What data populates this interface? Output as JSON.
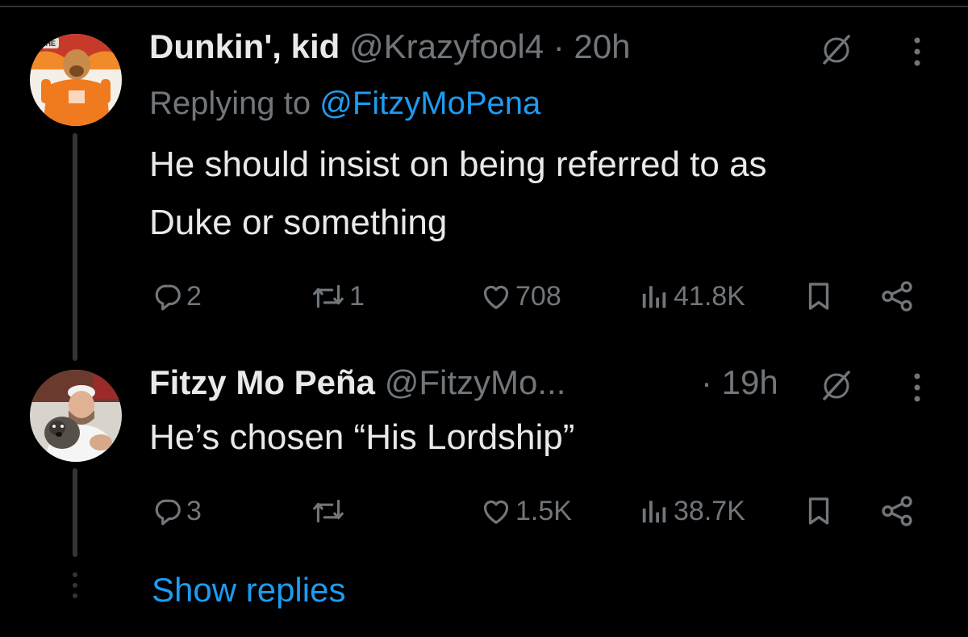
{
  "tweets": [
    {
      "display_name": "Dunkin', kid",
      "handle": "@Krazyfool4",
      "separator": " · ",
      "time": "20h",
      "reply_prefix": "Replying to ",
      "reply_handle": "@FitzyMoPena",
      "text_line1": "He should insist on being referred to as",
      "text_line2": "Duke or something",
      "replies": "2",
      "reposts": "1",
      "likes": "708",
      "views": "41.8K",
      "avatar_caption": "THE"
    },
    {
      "display_name": "Fitzy Mo Peña",
      "handle": "@FitzyMo...",
      "separator": " · ",
      "time": "19h",
      "text_line1": "He’s chosen “His Lordship”",
      "replies": "3",
      "reposts": "",
      "likes": "1.5K",
      "views": "38.7K"
    }
  ],
  "show_replies": "Show replies",
  "icons": [
    "grok-icon",
    "more-icon",
    "reply-icon",
    "repost-icon",
    "like-icon",
    "views-icon",
    "bookmark-icon",
    "share-icon"
  ],
  "colors": {
    "background": "#000000",
    "text": "#e7e9ea",
    "muted": "#71767b",
    "link": "#1d9bf0",
    "line": "#333639"
  }
}
